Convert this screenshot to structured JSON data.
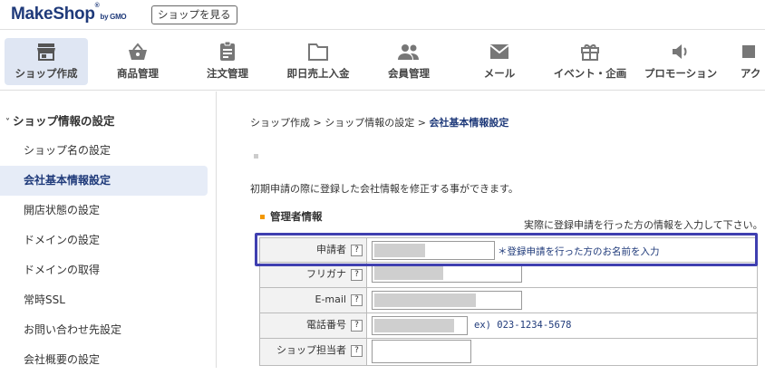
{
  "header": {
    "logo_text": "MakeShop",
    "logo_sub": "by GMO",
    "view_shop": "ショップを見る"
  },
  "nav": [
    {
      "label": "ショップ作成",
      "icon": "store-icon"
    },
    {
      "label": "商品管理",
      "icon": "shopping-basket-icon"
    },
    {
      "label": "注文管理",
      "icon": "clipboard-icon"
    },
    {
      "label": "即日売上入金",
      "icon": "folder-icon"
    },
    {
      "label": "会員管理",
      "icon": "people-icon"
    },
    {
      "label": "メール",
      "icon": "mail-icon"
    },
    {
      "label": "イベント・企画",
      "icon": "gift-icon"
    },
    {
      "label": "プロモーション",
      "icon": "speaker-icon"
    },
    {
      "label": "アク",
      "icon": "partial-icon"
    }
  ],
  "sidebar": {
    "heading": "ショップ情報の設定",
    "items": [
      "ショップ名の設定",
      "会社基本情報設定",
      "開店状態の設定",
      "ドメインの設定",
      "ドメインの取得",
      "常時SSL",
      "お問い合わせ先設定",
      "会社概要の設定"
    ]
  },
  "breadcrumb": {
    "part1": "ショップ作成",
    "sep": " > ",
    "part2": "ショップ情報の設定",
    "current": "会社基本情報設定"
  },
  "description": "初期申請の際に登録した会社情報を修正する事ができます。",
  "section": {
    "title": "管理者情報",
    "note": "実際に登録申請を行った方の情報を入力して下さい。"
  },
  "form": {
    "help_glyph": "?",
    "fields": [
      {
        "label": "申請者",
        "hint": "＊登録申請を行った方のお名前を入力"
      },
      {
        "label": "フリガナ",
        "hint": ""
      },
      {
        "label": "E-mail",
        "hint": ""
      },
      {
        "label": "電話番号",
        "hint": "ex) 023-1234-5678"
      },
      {
        "label": "ショップ担当者",
        "hint": ""
      }
    ]
  },
  "colors": {
    "brand": "#1f3a7a",
    "highlight": "#3f3fb0",
    "accent": "#f39800"
  }
}
